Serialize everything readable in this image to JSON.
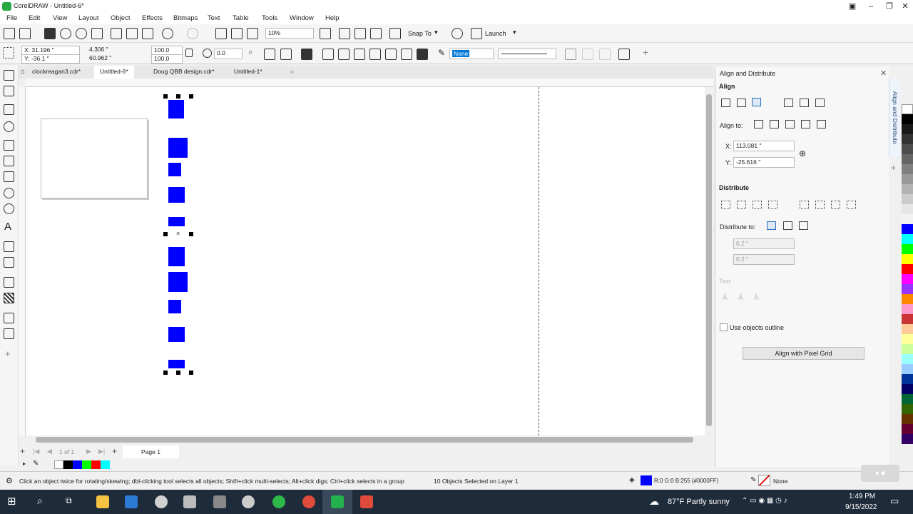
{
  "app": {
    "title": "CorelDRAW - Untitled-6*"
  },
  "menu": [
    "File",
    "Edit",
    "View",
    "Layout",
    "Object",
    "Effects",
    "Bitmaps",
    "Text",
    "Table",
    "Tools",
    "Window",
    "Help"
  ],
  "toolbar1": {
    "zoom": "10%",
    "snap_to": "Snap To",
    "launch": "Launch"
  },
  "toolbar2": {
    "x": "X: 31.196 \"",
    "y": "Y: -36.1 \"",
    "w": "4.306 \"",
    "h": "60.962 \"",
    "scale_w": "100.0",
    "scale_h": "100.0",
    "angle": "0.0",
    "outline_none": "None"
  },
  "doc_tabs": [
    "clockreagan3.cdr*",
    "Untitled-6*",
    "Doug QBB design.cdr*",
    "Untitled-1*"
  ],
  "page_nav": {
    "pages": "1 of 1",
    "page_label": "Page 1"
  },
  "docker": {
    "title": "Align and Distribute",
    "align": "Align",
    "align_to": "Align to:",
    "x_label": "X:",
    "x_value": "113.081 \"",
    "y_label": "Y:",
    "y_value": "-25.616 \"",
    "distribute": "Distribute",
    "distribute_to": "Distribute to:",
    "h_val": "0.2 \"",
    "v_val": "0.2 \"",
    "text": "Text",
    "use_outline": "Use objects outline",
    "pixel_grid_btn": "Align with Pixel Grid",
    "side_tab": "Align and Distribute"
  },
  "status": {
    "hint": "Click an object twice for rotating/skewing; dbl-clicking tool selects all objects; Shift+click multi-selects; Alt+click digs; Ctrl+click selects in a group",
    "selection": "10 Objects Selected on Layer 1",
    "fill_color": "R:0 G:0 B:255 (#0000FF)",
    "outline": "None",
    "fill_hex": "#0000ff"
  },
  "taskbar": {
    "weather": "87°F  Partly sunny",
    "time": "1:49 PM",
    "date": "9/15/2022"
  },
  "palette_colors": [
    "#ffffff",
    "#000000",
    "#0000ff",
    "#00ffff",
    "#00ff00",
    "#ffff00",
    "#ff0000",
    "#ff00ff",
    "#ff8800",
    "#888888",
    "#c0c0c0",
    "#663300",
    "#cc0066",
    "#9999ff"
  ],
  "status_swatches": [
    "#ffffff",
    "#000000",
    "#0000ff",
    "#00ff00",
    "#ff0000",
    "#00ffff"
  ]
}
